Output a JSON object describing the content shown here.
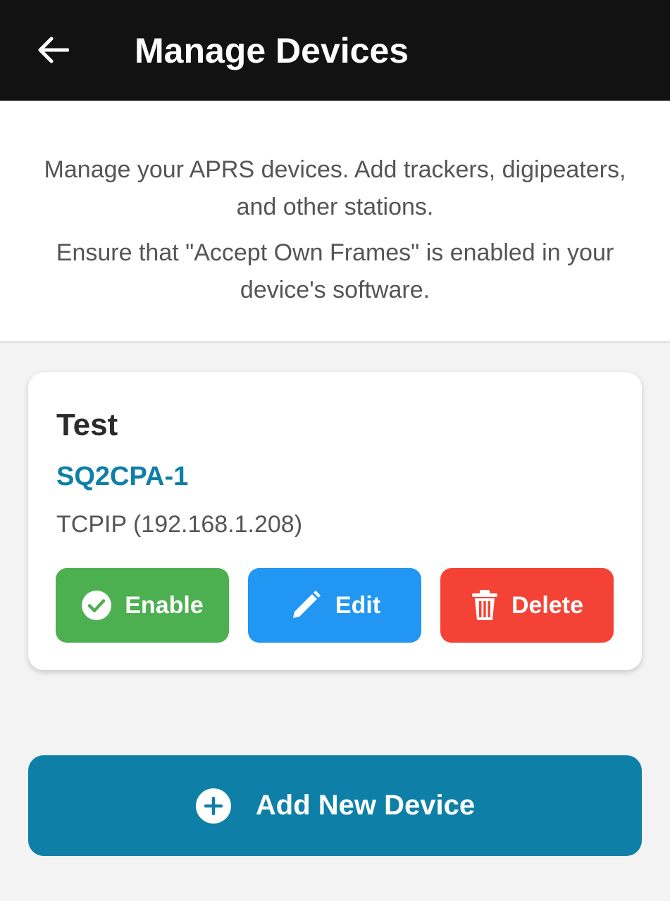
{
  "app_bar": {
    "title": "Manage Devices",
    "back_icon": "arrow-left-icon"
  },
  "info": {
    "description": "Manage your APRS devices. Add trackers, digipeaters, and other stations.",
    "note": "Ensure that \"Accept Own Frames\" is enabled in your device's software."
  },
  "devices": [
    {
      "name": "Test",
      "callsign": "SQ2CPA-1",
      "connection": "TCPIP (192.168.1.208)",
      "enable_label": "Enable",
      "edit_label": "Edit",
      "delete_label": "Delete"
    }
  ],
  "add_button": {
    "label": "Add New Device",
    "icon": "plus-circle-icon"
  },
  "colors": {
    "app_bar": "#121212",
    "accent": "#0e7fa6",
    "enable": "#4caf50",
    "edit": "#2196f3",
    "delete": "#f44336"
  }
}
